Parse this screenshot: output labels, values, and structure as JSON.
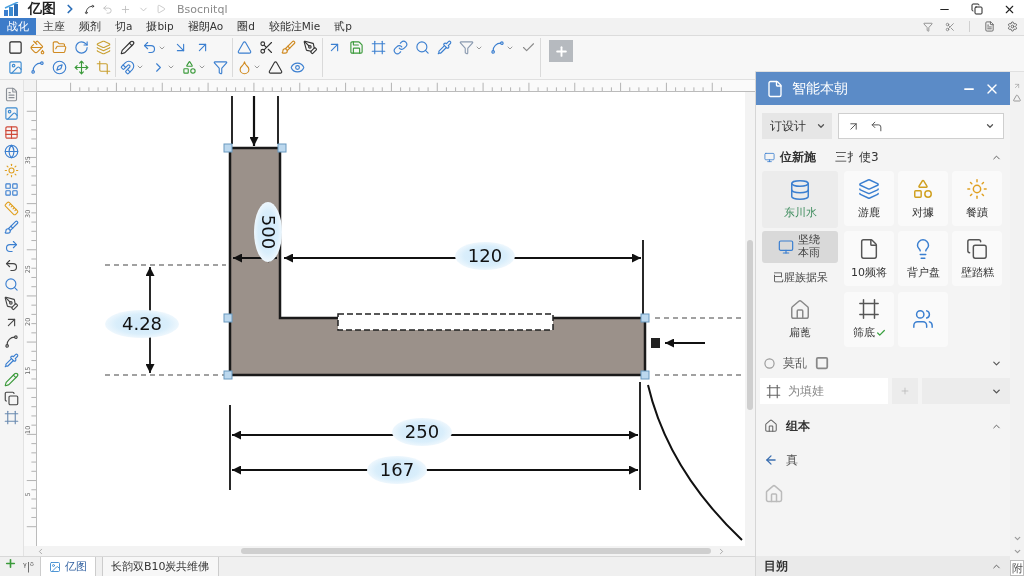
{
  "title_bar": {
    "app_name": "亿图",
    "document": "Bsocnitql"
  },
  "menu": {
    "tabs": [
      {
        "label": "战化",
        "selected": true
      },
      {
        "label": "主座",
        "selected": false
      },
      {
        "label": "频剂",
        "selected": false
      },
      {
        "label": "切a",
        "selected": false
      },
      {
        "label": "摄bip",
        "selected": false
      },
      {
        "label": "褪朗Ao",
        "selected": false
      },
      {
        "label": "圈d",
        "selected": false
      },
      {
        "label": "较能注Mie",
        "selected": false
      },
      {
        "label": "甙p",
        "selected": false
      }
    ]
  },
  "ruler": {
    "labels": [
      "35",
      "30",
      "25",
      "20",
      "15",
      "10",
      "5"
    ]
  },
  "drawing": {
    "dimension_labels": [
      "500",
      "120",
      "4.28",
      "250",
      "167"
    ]
  },
  "panel": {
    "title": "智能本朝",
    "design_dropdown": {
      "label": "订设计"
    },
    "shape_section": {
      "title": "位新施",
      "subtitle": "三扌使3",
      "expanded": true
    },
    "side_items": [
      {
        "kind": "tile",
        "label": "东川水",
        "selected": false
      },
      {
        "kind": "row",
        "label": "坚绕本雨",
        "selected": true
      },
      {
        "kind": "text",
        "label": "已腥族据呆",
        "selected": false
      },
      {
        "kind": "tile",
        "label": "扁蓖",
        "selected": false
      }
    ],
    "tiles": [
      {
        "kind": "labeled",
        "label": "游鹿",
        "checked": false
      },
      {
        "kind": "labeled",
        "label": "对據",
        "checked": false
      },
      {
        "kind": "labeled",
        "label": "餐蹟",
        "checked": false
      },
      {
        "kind": "labeled",
        "label": "10频将",
        "checked": false
      },
      {
        "kind": "labeled",
        "label": "背户盘",
        "checked": false
      },
      {
        "kind": "labeled",
        "label": "壁踏糕",
        "checked": false
      },
      {
        "kind": "labeled",
        "label": "筛底",
        "checked": true
      },
      {
        "kind": "icon_only",
        "checked": false
      }
    ],
    "style_section": {
      "title": "莫乱",
      "expanded": false
    },
    "search": {
      "placeholder": "为填娃"
    },
    "group_section": {
      "title": "组本",
      "expanded": true
    },
    "back_item": {
      "label": "真"
    },
    "bottom_section": {
      "title": "目朔",
      "expanded": true
    }
  },
  "scrollbar": {
    "button": "附"
  },
  "status_bar": {
    "page_indicator": "ᵞ|ᵟ",
    "tabs": [
      {
        "label": "亿图",
        "selected": true
      },
      {
        "label": "长韵双B10炭共维佛",
        "selected": false
      }
    ]
  }
}
